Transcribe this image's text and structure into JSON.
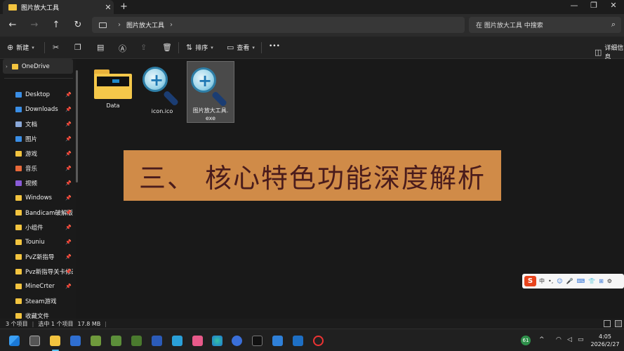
{
  "window": {
    "tab_title": "图片放大工具",
    "tab_close": "✕",
    "new_tab": "+",
    "controls": [
      "—",
      "❐",
      "✕"
    ]
  },
  "nav": {
    "back": "←",
    "forward": "→",
    "up": "↑",
    "refresh": "↻"
  },
  "address": {
    "crumb": "图片放大工具",
    "sep1": "›",
    "sep2": "›"
  },
  "search": {
    "placeholder": "在 图片放大工具 中搜索",
    "icon": "search-icon"
  },
  "commands": {
    "new": "新建",
    "sort": "排序",
    "view": "查看",
    "more": "•••",
    "details": "详细信息"
  },
  "sidebar": {
    "onedrive": "OneDrive",
    "items": [
      {
        "label": "Desktop",
        "color": "#3a8ee6"
      },
      {
        "label": "Downloads",
        "color": "#3a8ee6"
      },
      {
        "label": "文档",
        "color": "#8aa8d8"
      },
      {
        "label": "图片",
        "color": "#3a8ee6"
      },
      {
        "label": "游戏",
        "color": "#f3c43f"
      },
      {
        "label": "音乐",
        "color": "#e8693a"
      },
      {
        "label": "视频",
        "color": "#8a5cd8"
      },
      {
        "label": "Windows",
        "color": "#f3c43f"
      },
      {
        "label": "Bandicam破解版",
        "color": "#f3c43f"
      },
      {
        "label": "小组件",
        "color": "#f3c43f"
      },
      {
        "label": "Touniu",
        "color": "#f3c43f"
      },
      {
        "label": "PvZ新指导",
        "color": "#f3c43f"
      },
      {
        "label": "Pvz新指导关卡修改",
        "color": "#f3c43f"
      },
      {
        "label": "MineCrter",
        "color": "#f3c43f"
      },
      {
        "label": "Steam游戏",
        "color": "#f3c43f"
      },
      {
        "label": "收藏文件",
        "color": "#f3c43f"
      }
    ]
  },
  "files": [
    {
      "name": "Data",
      "type": "folder"
    },
    {
      "name": "icon.ico",
      "type": "icon"
    },
    {
      "name": "图片放大工具.",
      "name2": "exe",
      "type": "exe"
    }
  ],
  "banner": {
    "text": "三、 核心特色功能深度解析",
    "color": "#d08b48"
  },
  "ime": {
    "logo": "S",
    "mode": "中",
    "items": [
      "•,",
      "☺",
      "🎤",
      "⌨",
      "👕",
      "⊞",
      "⚙"
    ]
  },
  "status": {
    "count": "3 个项目",
    "selected": "选中 1 个项目",
    "size": "17.8 MB"
  },
  "tray": {
    "badge": "61",
    "chevron": "^",
    "time": "4:05",
    "date": "2026/2/27"
  }
}
